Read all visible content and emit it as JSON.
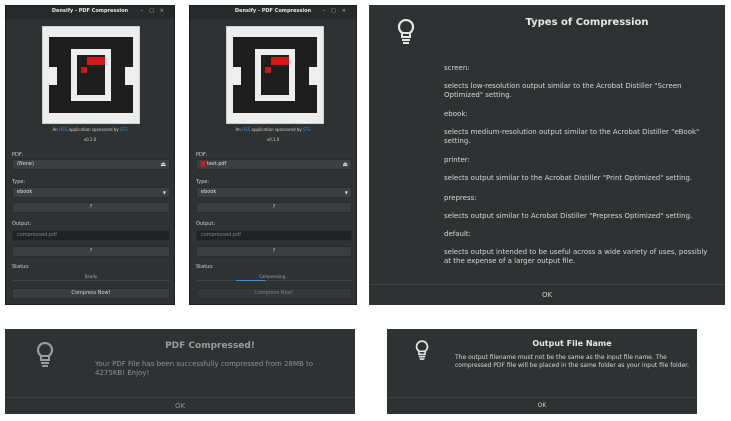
{
  "colors": {
    "window_bg": "#2f3233",
    "accent": "#d01818",
    "progress": "#3b8fd6"
  },
  "win1": {
    "title": "Densify - PDF Compression",
    "controls": [
      "–",
      "□",
      "×"
    ],
    "about_prefix": "An",
    "about_link1": "OSS",
    "about_middle": "application sponsored by",
    "about_link2": "STS",
    "version": "v0.1.0",
    "pdf_label": "PDF:",
    "pdf_value": "(None)",
    "type_label": "Type:",
    "type_value": "ebook",
    "type_help": "?",
    "output_label": "Output:",
    "output_placeholder": "compressed.pdf",
    "output_help": "?",
    "status_label": "Status:",
    "status_value": "Ready",
    "compress_label": "Compress Now!"
  },
  "win2": {
    "title": "Densify - PDF Compression",
    "controls": [
      "–",
      "□",
      "×"
    ],
    "about_prefix": "An",
    "about_link1": "OSS",
    "about_middle": "application sponsored by",
    "about_link2": "STS",
    "version": "v0.1.0",
    "pdf_label": "PDF:",
    "pdf_value": "test.pdf",
    "type_label": "Type:",
    "type_value": "ebook",
    "type_help": "?",
    "output_label": "Output:",
    "output_placeholder": "compressed.pdf",
    "output_help": "?",
    "status_label": "Status:",
    "status_value": "Compressing...",
    "progress": 0.5,
    "compress_label": "Compress Now!"
  },
  "types_dialog": {
    "heading": "Types of Compression",
    "lines": [
      "screen:",
      "selects low-resolution output similar to the Acrobat Distiller \"Screen Optimized\" setting.",
      "ebook:",
      "selects medium-resolution output similar to the Acrobat Distiller \"eBook\" setting.",
      "printer:",
      "selects output similar to the Acrobat Distiller \"Print Optimized\" setting.",
      "prepress:",
      "selects output similar to Acrobat Distiller \"Prepress Optimized\" setting.",
      "default:",
      "selects output intended to be useful across a wide variety of uses, possibly at the expense of a larger output file."
    ],
    "ok_label": "OK"
  },
  "compressed_dialog": {
    "heading": "PDF Compressed!",
    "message": "Your PDF File has been successfully compressed from 28MB to 4275KB! Enjoy!",
    "ok_label": "OK"
  },
  "output_dialog": {
    "heading": "Output File Name",
    "message": "The output filename must not be the same as the input file name. The compressed PDF file will be placed in the same folder as your input file folder.",
    "ok_label": "OK"
  }
}
